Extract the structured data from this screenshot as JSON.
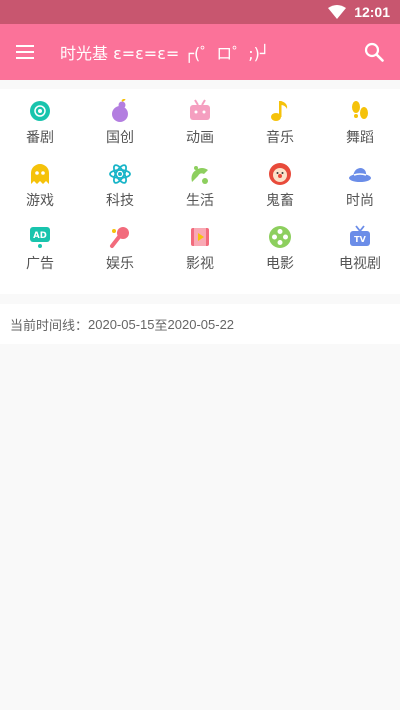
{
  "status": {
    "time": "12:01"
  },
  "appbar": {
    "title": "时光基 ε=ε=ε= ┌(゜ロ゜;)┘"
  },
  "categories": [
    {
      "label": "番剧",
      "icon": "anime-disc-icon",
      "color": "#19c4ad"
    },
    {
      "label": "国创",
      "icon": "gourd-icon",
      "color": "#b37ee0"
    },
    {
      "label": "动画",
      "icon": "tv-mascot-icon",
      "color": "#f59fc0"
    },
    {
      "label": "音乐",
      "icon": "music-note-icon",
      "color": "#f5c20a"
    },
    {
      "label": "舞蹈",
      "icon": "footprints-icon",
      "color": "#f5c20a"
    },
    {
      "label": "游戏",
      "icon": "ghost-icon",
      "color": "#f5c20a"
    },
    {
      "label": "科技",
      "icon": "atom-icon",
      "color": "#19b5c8"
    },
    {
      "label": "生活",
      "icon": "life-icon",
      "color": "#8dcf5e"
    },
    {
      "label": "鬼畜",
      "icon": "clown-icon",
      "color": "#e84a3a"
    },
    {
      "label": "时尚",
      "icon": "hat-icon",
      "color": "#6b8de8"
    },
    {
      "label": "广告",
      "icon": "ad-icon",
      "color": "#19c4ad"
    },
    {
      "label": "娱乐",
      "icon": "microphone-icon",
      "color": "#f26b7c"
    },
    {
      "label": "影视",
      "icon": "film-icon",
      "color": "#f26b7c"
    },
    {
      "label": "电影",
      "icon": "film-reel-icon",
      "color": "#8dcf5e"
    },
    {
      "label": "电视剧",
      "icon": "tv-icon",
      "color": "#6b8de8"
    }
  ],
  "timeline": {
    "prefix": "当前时间线：",
    "start": "2020-05-15",
    "sep": " 至 ",
    "end": "2020-05-22"
  }
}
